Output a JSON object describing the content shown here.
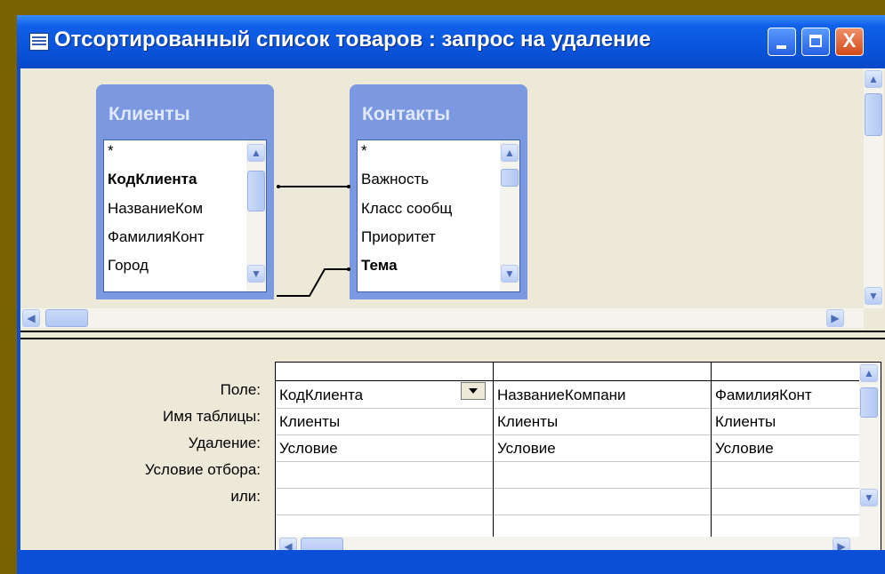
{
  "window": {
    "title": "Отсортированный список товаров : запрос на удаление",
    "close_glyph": "X"
  },
  "tables": [
    {
      "name": "Клиенты",
      "fields": [
        "*",
        "КодКлиента",
        "НазваниеКом",
        "ФамилияКонт",
        "Город"
      ],
      "bold": [
        1
      ]
    },
    {
      "name": "Контакты",
      "fields": [
        "*",
        "Важность",
        "Класс сообщ",
        "Приоритет",
        "Тема"
      ],
      "bold": [
        4
      ]
    }
  ],
  "grid": {
    "row_labels": [
      "Поле:",
      "Имя таблицы:",
      "Удаление:",
      "Условие отбора:",
      "или:"
    ],
    "columns": [
      {
        "field": "КодКлиента",
        "table": "Клиенты",
        "delete": "Условие"
      },
      {
        "field": "НазваниеКомпани",
        "table": "Клиенты",
        "delete": "Условие"
      },
      {
        "field": "ФамилияКонт",
        "table": "Клиенты",
        "delete": "Условие"
      }
    ]
  },
  "icons": {
    "window_icon": "query-icon",
    "minimize": "minimize-icon",
    "maximize": "maximize-icon",
    "close": "close-icon",
    "scroll_up": "▲",
    "scroll_down": "▼",
    "scroll_left": "◀",
    "scroll_right": "▶"
  },
  "colors": {
    "desktop": "#7a6200",
    "titlebar": "#0a55dc",
    "table_header": "#7c98e0"
  }
}
